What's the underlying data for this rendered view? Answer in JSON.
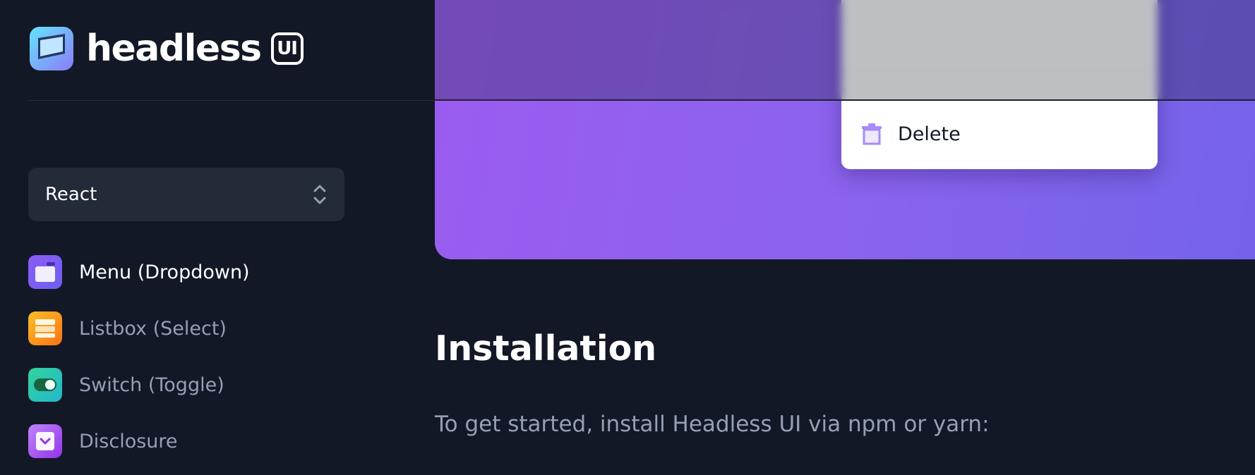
{
  "logo": {
    "wordmark": "headless",
    "badge": "UI"
  },
  "framework_select": {
    "value": "React",
    "icon": "chevron-up-down-icon"
  },
  "nav": {
    "items": [
      {
        "label": "Menu (Dropdown)",
        "icon": "menu-icon",
        "active": true,
        "color": "#7c5cf3"
      },
      {
        "label": "Listbox (Select)",
        "icon": "listbox-icon",
        "active": false,
        "color": "#f6b640"
      },
      {
        "label": "Switch (Toggle)",
        "icon": "switch-icon",
        "active": false,
        "color": "#3fcf8e"
      },
      {
        "label": "Disclosure",
        "icon": "disclosure-icon",
        "active": false,
        "color": "#a855f7"
      }
    ]
  },
  "hero": {
    "menu": {
      "items": [
        {
          "label": "Delete",
          "icon": "trash-icon"
        }
      ]
    }
  },
  "main": {
    "section_title": "Installation",
    "intro": "To get started, install Headless UI via npm or yarn:"
  },
  "colors": {
    "background": "#131826",
    "hero_gradient_start": "#9b5cf0",
    "hero_gradient_end": "#7263e8",
    "accent": "#8b5cf6"
  }
}
